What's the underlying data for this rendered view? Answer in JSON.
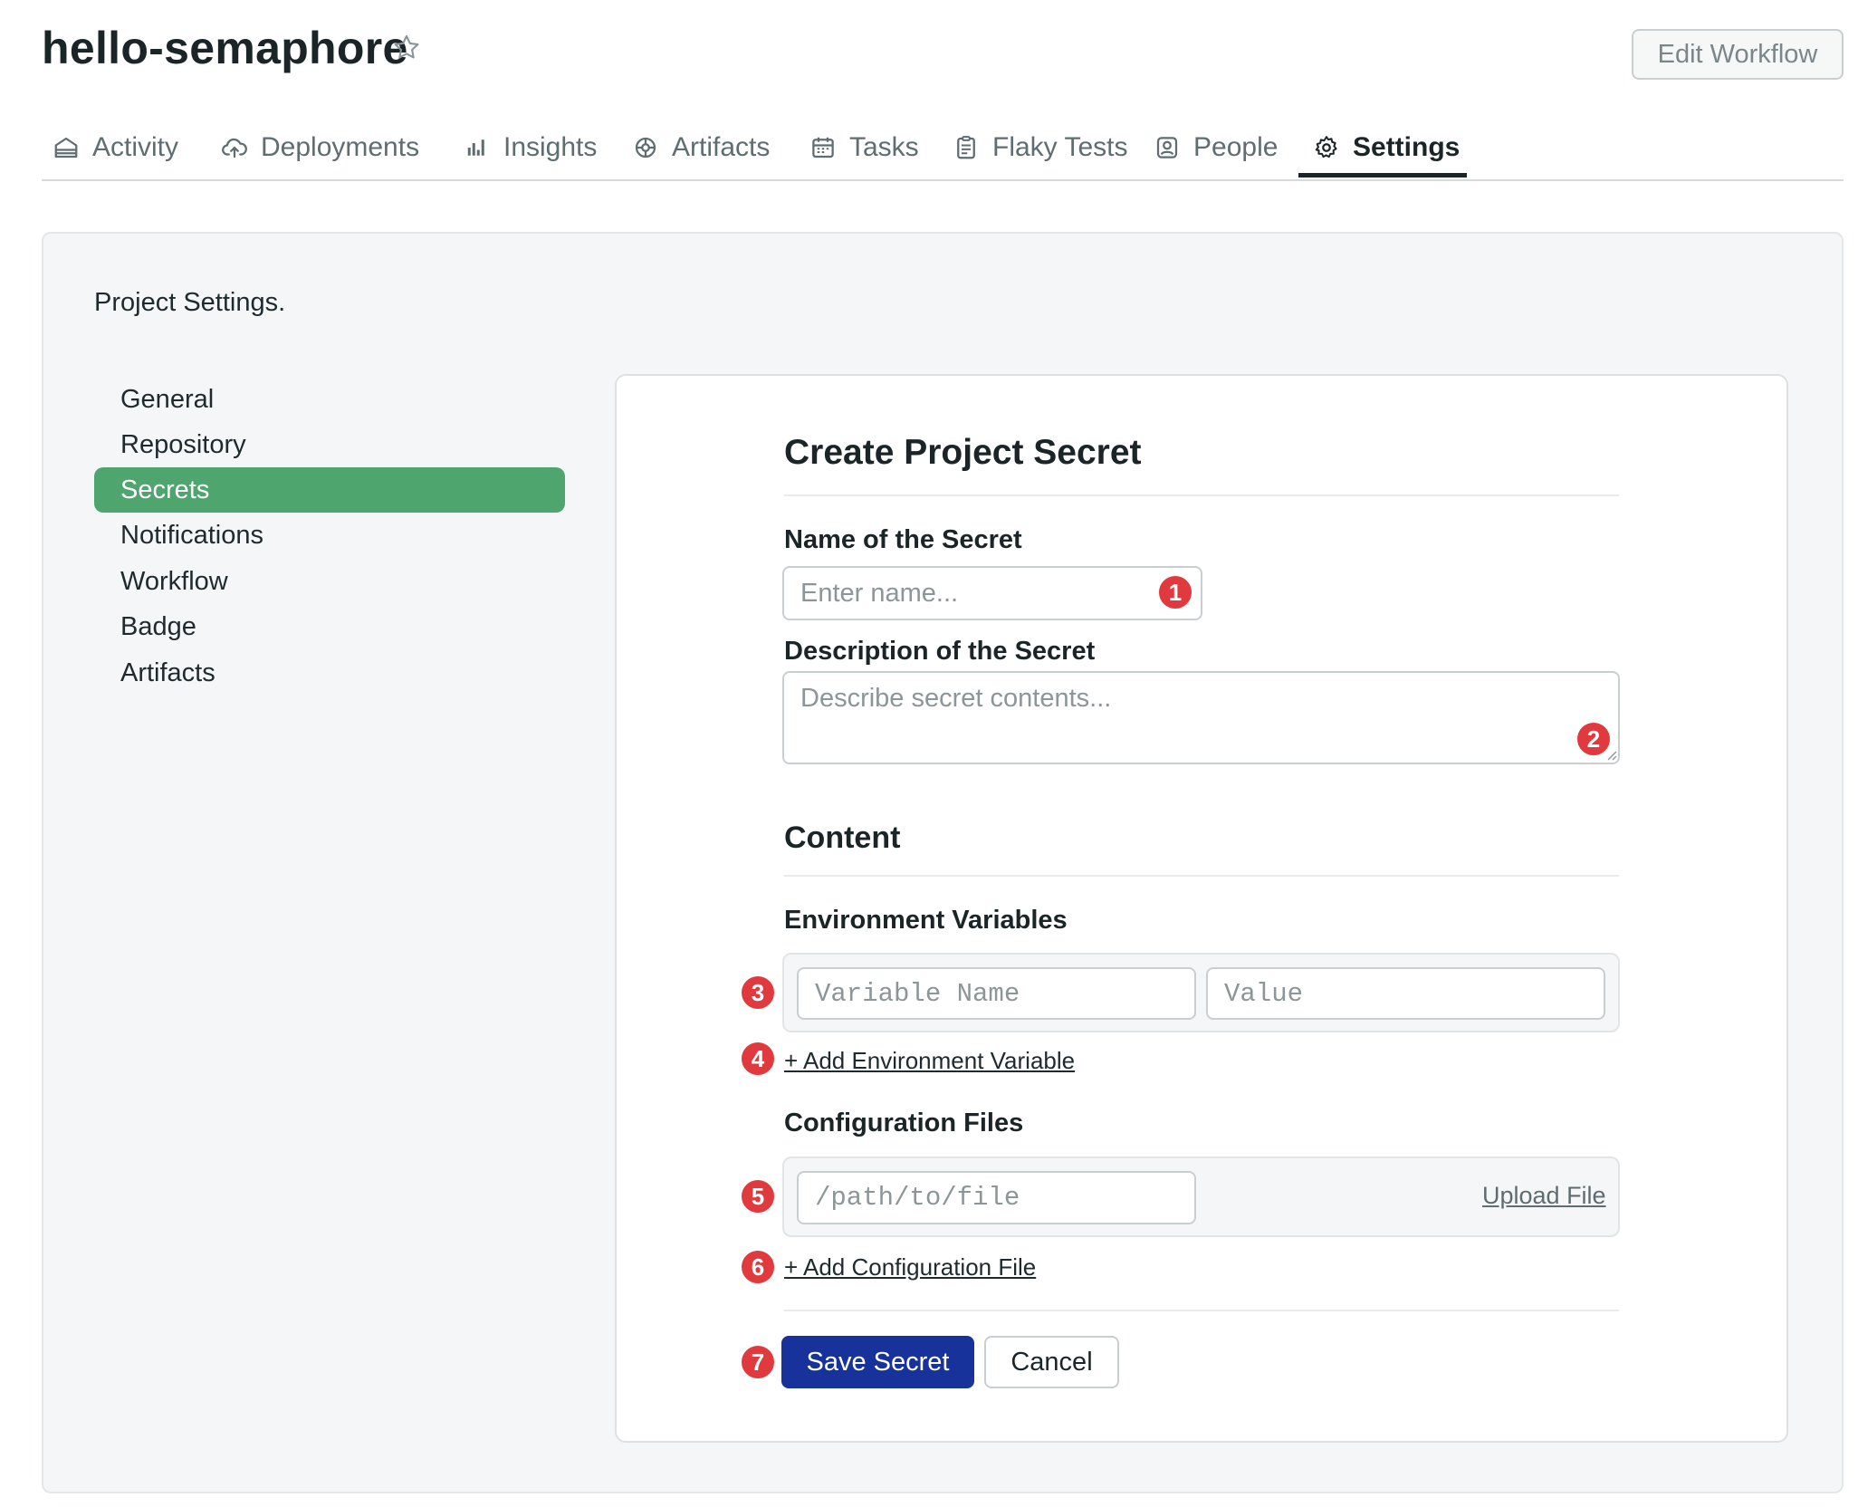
{
  "project": {
    "name": "hello-semaphore",
    "edit_workflow_label": "Edit Workflow"
  },
  "tabs": [
    {
      "label": "Activity",
      "icon": "home-icon"
    },
    {
      "label": "Deployments",
      "icon": "cloud-upload-icon"
    },
    {
      "label": "Insights",
      "icon": "bar-chart-icon"
    },
    {
      "label": "Artifacts",
      "icon": "artifact-icon"
    },
    {
      "label": "Tasks",
      "icon": "calendar-icon"
    },
    {
      "label": "Flaky Tests",
      "icon": "clipboard-icon"
    },
    {
      "label": "People",
      "icon": "person-icon"
    },
    {
      "label": "Settings",
      "icon": "gear-icon",
      "active": true
    }
  ],
  "settings": {
    "title": "Project Settings.",
    "nav": [
      "General",
      "Repository",
      "Secrets",
      "Notifications",
      "Workflow",
      "Badge",
      "Artifacts"
    ],
    "active_nav": "Secrets"
  },
  "form": {
    "heading": "Create Project Secret",
    "name_label": "Name of the Secret",
    "name_placeholder": "Enter name...",
    "description_label": "Description of the Secret",
    "description_placeholder": "Describe secret contents...",
    "content_heading": "Content",
    "env_heading": "Environment Variables",
    "env_name_placeholder": "Variable Name",
    "env_value_placeholder": "Value",
    "add_env_label": "+ Add Environment Variable",
    "config_heading": "Configuration Files",
    "file_path_placeholder": "/path/to/file",
    "upload_label": "Upload File",
    "add_config_label": "+ Add Configuration File",
    "save_label": "Save Secret",
    "cancel_label": "Cancel"
  },
  "markers": [
    "1",
    "2",
    "3",
    "4",
    "5",
    "6",
    "7"
  ],
  "colors": {
    "accent_green": "#4ea56e",
    "primary_blue": "#17339b",
    "marker_red": "#e0393e"
  }
}
